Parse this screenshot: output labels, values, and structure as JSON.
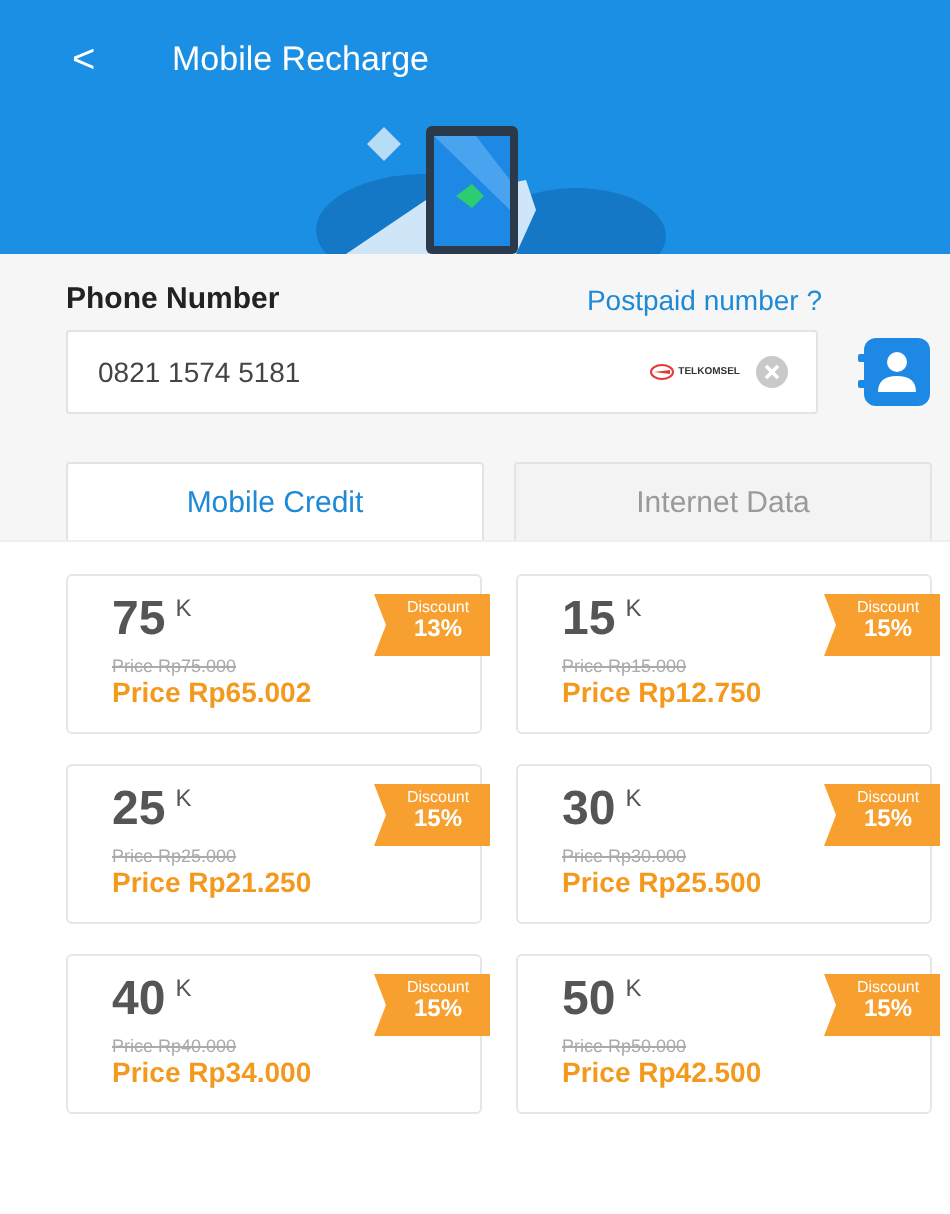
{
  "header": {
    "back": "<",
    "title": "Mobile Recharge"
  },
  "phone": {
    "label": "Phone Number",
    "link": "Postpaid number ?",
    "value": "0821 1574 5181",
    "operator": "TELKOMSEL"
  },
  "tabs": [
    {
      "label": "Mobile Credit",
      "selected": true
    },
    {
      "label": "Internet Data",
      "selected": false
    }
  ],
  "products": [
    {
      "amount": "75",
      "unit": "K",
      "discount_label": "Discount",
      "discount": "13%",
      "original_price": "Price Rp75.000",
      "price": "Price Rp65.002"
    },
    {
      "amount": "15",
      "unit": "K",
      "discount_label": "Discount",
      "discount": "15%",
      "original_price": "Price Rp15.000",
      "price": "Price Rp12.750"
    },
    {
      "amount": "25",
      "unit": "K",
      "discount_label": "Discount",
      "discount": "15%",
      "original_price": "Price Rp25.000",
      "price": "Price Rp21.250"
    },
    {
      "amount": "30",
      "unit": "K",
      "discount_label": "Discount",
      "discount": "15%",
      "original_price": "Price Rp30.000",
      "price": "Price Rp25.500"
    },
    {
      "amount": "40",
      "unit": "K",
      "discount_label": "Discount",
      "discount": "15%",
      "original_price": "Price Rp40.000",
      "price": "Price Rp34.000"
    },
    {
      "amount": "50",
      "unit": "K",
      "discount_label": "Discount",
      "discount": "15%",
      "original_price": "Price Rp50.000",
      "price": "Price Rp42.500"
    }
  ]
}
